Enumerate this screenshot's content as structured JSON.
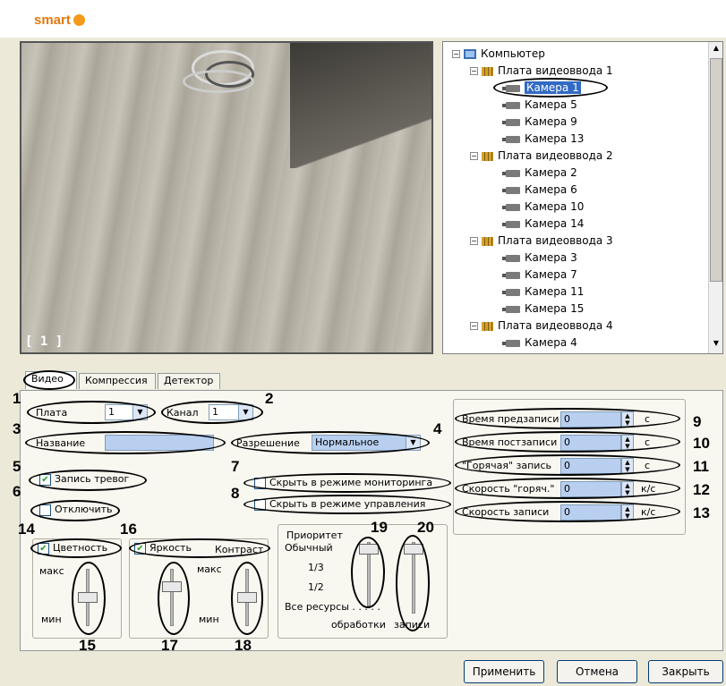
{
  "app": {
    "logo_text": "smart"
  },
  "video": {
    "overlay_label": "[ 1 ]"
  },
  "tree": {
    "root": "Компьютер",
    "boards": [
      {
        "label": "Плата видеоввода 1",
        "cameras": [
          "Камера 1",
          "Камера 5",
          "Камера 9",
          "Камера 13"
        ]
      },
      {
        "label": "Плата видеоввода 2",
        "cameras": [
          "Камера 2",
          "Камера 6",
          "Камера 10",
          "Камера 14"
        ]
      },
      {
        "label": "Плата видеоввода 3",
        "cameras": [
          "Камера 3",
          "Камера 7",
          "Камера 11",
          "Камера 15"
        ]
      },
      {
        "label": "Плата видеоввода 4",
        "cameras": [
          "Камера 4"
        ]
      }
    ],
    "selected": "Камера 1"
  },
  "tabs": [
    "Видео",
    "Компрессия",
    "Детектор"
  ],
  "form": {
    "board_label": "Плата",
    "board_value": "1",
    "channel_label": "Канал",
    "channel_value": "1",
    "name_label": "Название",
    "name_value": "",
    "resolution_label": "Разрешение",
    "resolution_value": "Нормальное",
    "alarm_record_label": "Запись тревог",
    "disable_label": "Отключить",
    "hide_monitoring_label": "Скрыть в режиме мониторинга",
    "hide_control_label": "Скрыть в режиме управления",
    "color_label": "Цветность",
    "brightness_label": "Яркость",
    "contrast_label": "Контраст",
    "max_label": "макс",
    "min_label": "мин",
    "priority": {
      "title": "Приоритет",
      "levels": [
        "Обычный",
        "1/3",
        "1/2",
        "Все ресурсы . . . . ."
      ],
      "processing_label": "обработки",
      "recording_label": "записи"
    },
    "timing": [
      {
        "label": "Время предзаписи",
        "value": "0",
        "unit": "с"
      },
      {
        "label": "Время постзаписи",
        "value": "0",
        "unit": "с"
      },
      {
        "label": "\"Горячая\" запись",
        "value": "0",
        "unit": "с"
      },
      {
        "label": "Скорость \"горяч.\"",
        "value": "0",
        "unit": "к/с"
      },
      {
        "label": "Скорость записи",
        "value": "0",
        "unit": "к/с"
      }
    ]
  },
  "callouts": [
    "1",
    "2",
    "3",
    "4",
    "5",
    "6",
    "7",
    "8",
    "9",
    "10",
    "11",
    "12",
    "13",
    "14",
    "15",
    "16",
    "17",
    "18",
    "19",
    "20"
  ],
  "buttons": {
    "apply": "Применить",
    "cancel": "Отмена",
    "close": "Закрыть"
  },
  "colors": {
    "selection": "#316ac5",
    "input_fill": "#b8cff0",
    "logo": "#e07a10"
  }
}
